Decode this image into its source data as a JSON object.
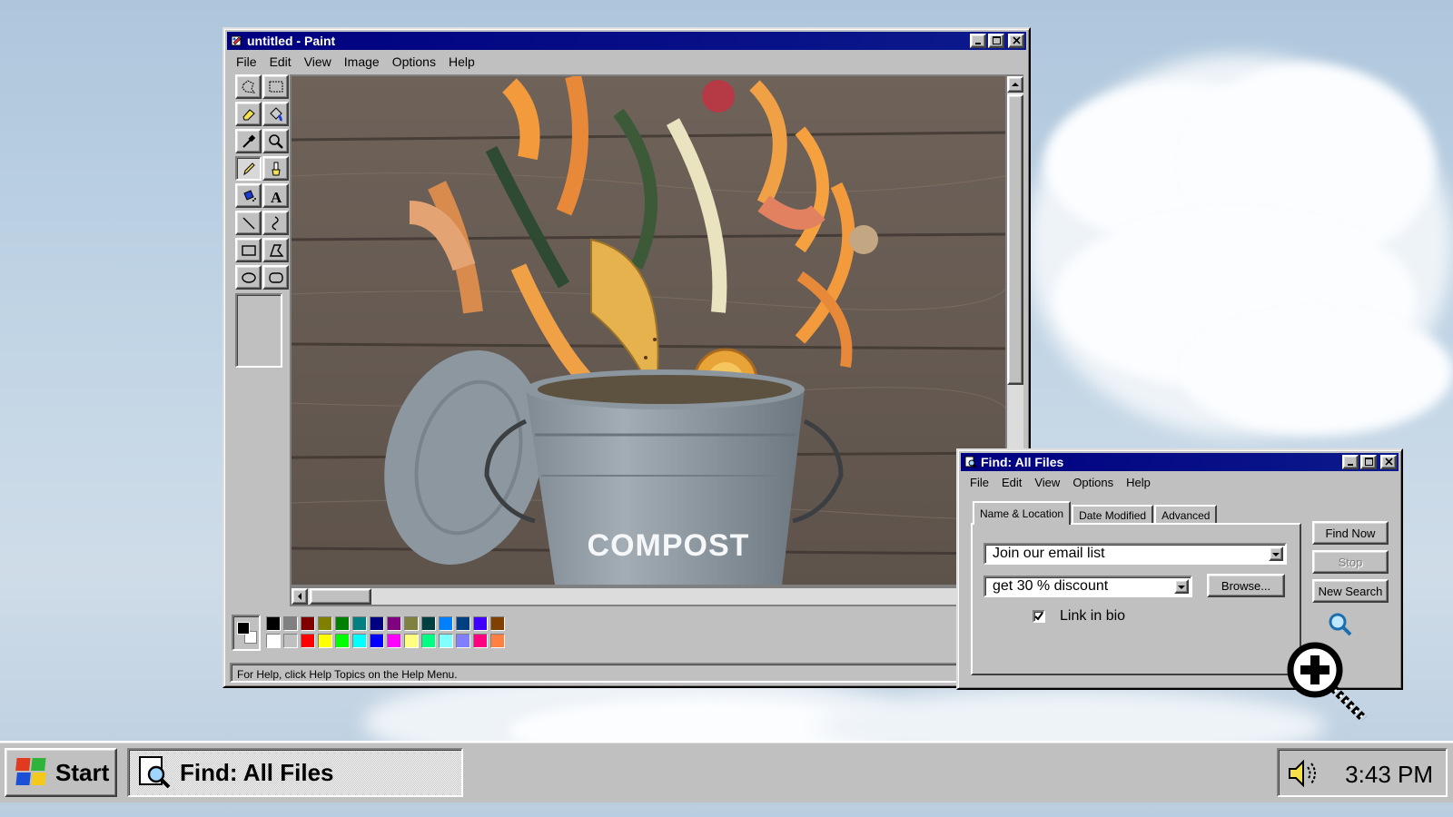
{
  "paint": {
    "title": "untitled - Paint",
    "menu": [
      "File",
      "Edit",
      "View",
      "Image",
      "Options",
      "Help"
    ],
    "status_text": "For Help, click Help Topics on the Help Menu.",
    "canvas_text": "COMPOST",
    "active_tool": "pencil",
    "palette_top": [
      "#000000",
      "#808080",
      "#800000",
      "#808000",
      "#008000",
      "#008080",
      "#000080",
      "#800080",
      "#808040",
      "#004040",
      "#0080ff",
      "#004080",
      "#4000ff",
      "#804000"
    ],
    "palette_bottom": [
      "#ffffff",
      "#c0c0c0",
      "#ff0000",
      "#ffff00",
      "#00ff00",
      "#00ffff",
      "#0000ff",
      "#ff00ff",
      "#ffff80",
      "#00ff80",
      "#80ffff",
      "#8080ff",
      "#ff0080",
      "#ff8040"
    ]
  },
  "find": {
    "title": "Find: All Files",
    "menu": [
      "File",
      "Edit",
      "View",
      "Options",
      "Help"
    ],
    "tabs": [
      "Name & Location",
      "Date Modified",
      "Advanced"
    ],
    "named_value": "Join our email list",
    "look_in_value": "get 30 % discount",
    "browse_label": "Browse...",
    "checkbox_label": "Link in bio",
    "checkbox_checked": true,
    "find_now_label": "Find Now",
    "stop_label": "Stop",
    "new_search_label": "New Search"
  },
  "taskbar": {
    "start_label": "Start",
    "task_label": "Find: All Files",
    "clock": "3:43 PM"
  }
}
